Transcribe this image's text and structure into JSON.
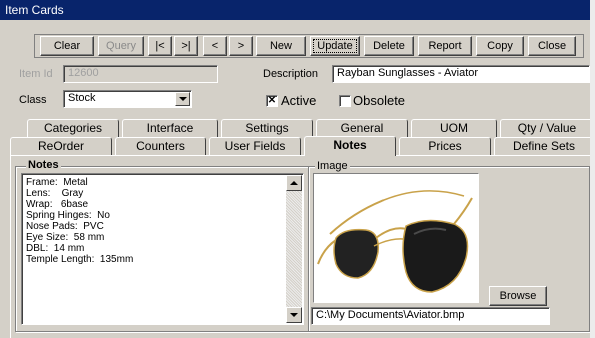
{
  "window": {
    "title": "Item Cards"
  },
  "toolbar": {
    "buttons": [
      {
        "label": "Clear",
        "enabled": true
      },
      {
        "label": "Query",
        "enabled": false
      },
      {
        "label": "|<",
        "enabled": true
      },
      {
        "label": ">|",
        "enabled": true
      },
      {
        "label": "<",
        "enabled": true
      },
      {
        "label": ">",
        "enabled": true
      },
      {
        "label": "New",
        "enabled": true
      },
      {
        "label": "Update",
        "enabled": true,
        "focused": true
      },
      {
        "label": "Delete",
        "enabled": true
      },
      {
        "label": "Report",
        "enabled": true
      },
      {
        "label": "Copy",
        "enabled": true
      },
      {
        "label": "Close",
        "enabled": true
      }
    ]
  },
  "form": {
    "item_id_label": "Item Id",
    "item_id_value": "12600",
    "description_label": "Description",
    "description_value": "Rayban Sunglasses - Aviator",
    "class_label": "Class",
    "class_value": "Stock",
    "active_label": "Active",
    "active_checked": true,
    "obsolete_label": "Obsolete",
    "obsolete_checked": false
  },
  "tabs": {
    "row1": [
      "Categories",
      "Interface",
      "Settings",
      "General",
      "UOM",
      "Qty / Value"
    ],
    "row2": [
      "ReOrder",
      "Counters",
      "User Fields",
      "Notes",
      "Prices",
      "Define Sets"
    ],
    "active": "Notes"
  },
  "notes": {
    "group_title": "Notes",
    "lines": [
      "Frame:  Metal",
      "Lens:    Gray",
      "Wrap:   6base",
      "Spring Hinges:  No",
      "Nose Pads:  PVC",
      "Eye Size:  58 mm",
      "DBL:  14 mm",
      "Temple Length:  135mm"
    ]
  },
  "image": {
    "group_title": "Image",
    "browse_label": "Browse",
    "path_value": "C:\\My Documents\\Aviator.bmp"
  },
  "colors": {
    "titlebar": "#08246b",
    "face": "#d4d0c8",
    "lens": "#222222",
    "frame": "#c9a24a"
  }
}
